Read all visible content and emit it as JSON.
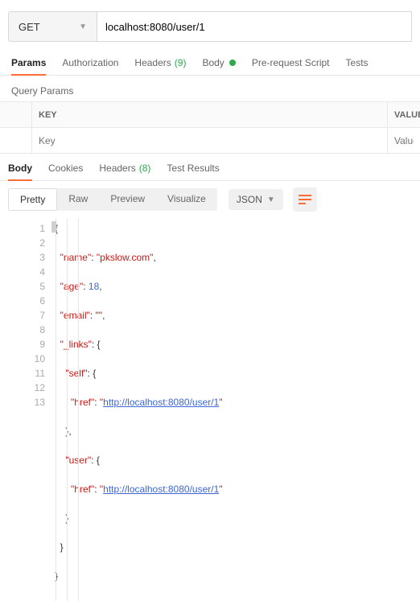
{
  "urlBar": {
    "method": "GET",
    "url": "localhost:8080/user/1"
  },
  "requestTabs": {
    "params": "Params",
    "authorization": "Authorization",
    "headers": "Headers",
    "headersCount": "(9)",
    "body": "Body",
    "preRequest": "Pre-request Script",
    "tests": "Tests"
  },
  "queryParams": {
    "title": "Query Params",
    "keyHeader": "KEY",
    "valueHeader": "VALUE",
    "keyPlaceholder": "Key",
    "valuePlaceholder": "Value"
  },
  "respTabs": {
    "body": "Body",
    "cookies": "Cookies",
    "headers": "Headers",
    "headersCount": "(8)",
    "testResults": "Test Results"
  },
  "viewRow": {
    "pretty": "Pretty",
    "raw": "Raw",
    "preview": "Preview",
    "visualize": "Visualize",
    "format": "JSON"
  },
  "code": {
    "lineNumbers": [
      "1",
      "2",
      "3",
      "4",
      "5",
      "6",
      "7",
      "8",
      "9",
      "10",
      "11",
      "12",
      "13"
    ],
    "name_k": "\"name\"",
    "name_v": "\"pkslow.com\"",
    "age_k": "\"age\"",
    "age_v": "18",
    "email_k": "\"email\"",
    "email_v": "\"\"",
    "links_k": "\"_links\"",
    "self_k": "\"self\"",
    "href_k": "\"href\"",
    "href_v": "http://localhost:8080/user/1",
    "user_k": "\"user\""
  }
}
